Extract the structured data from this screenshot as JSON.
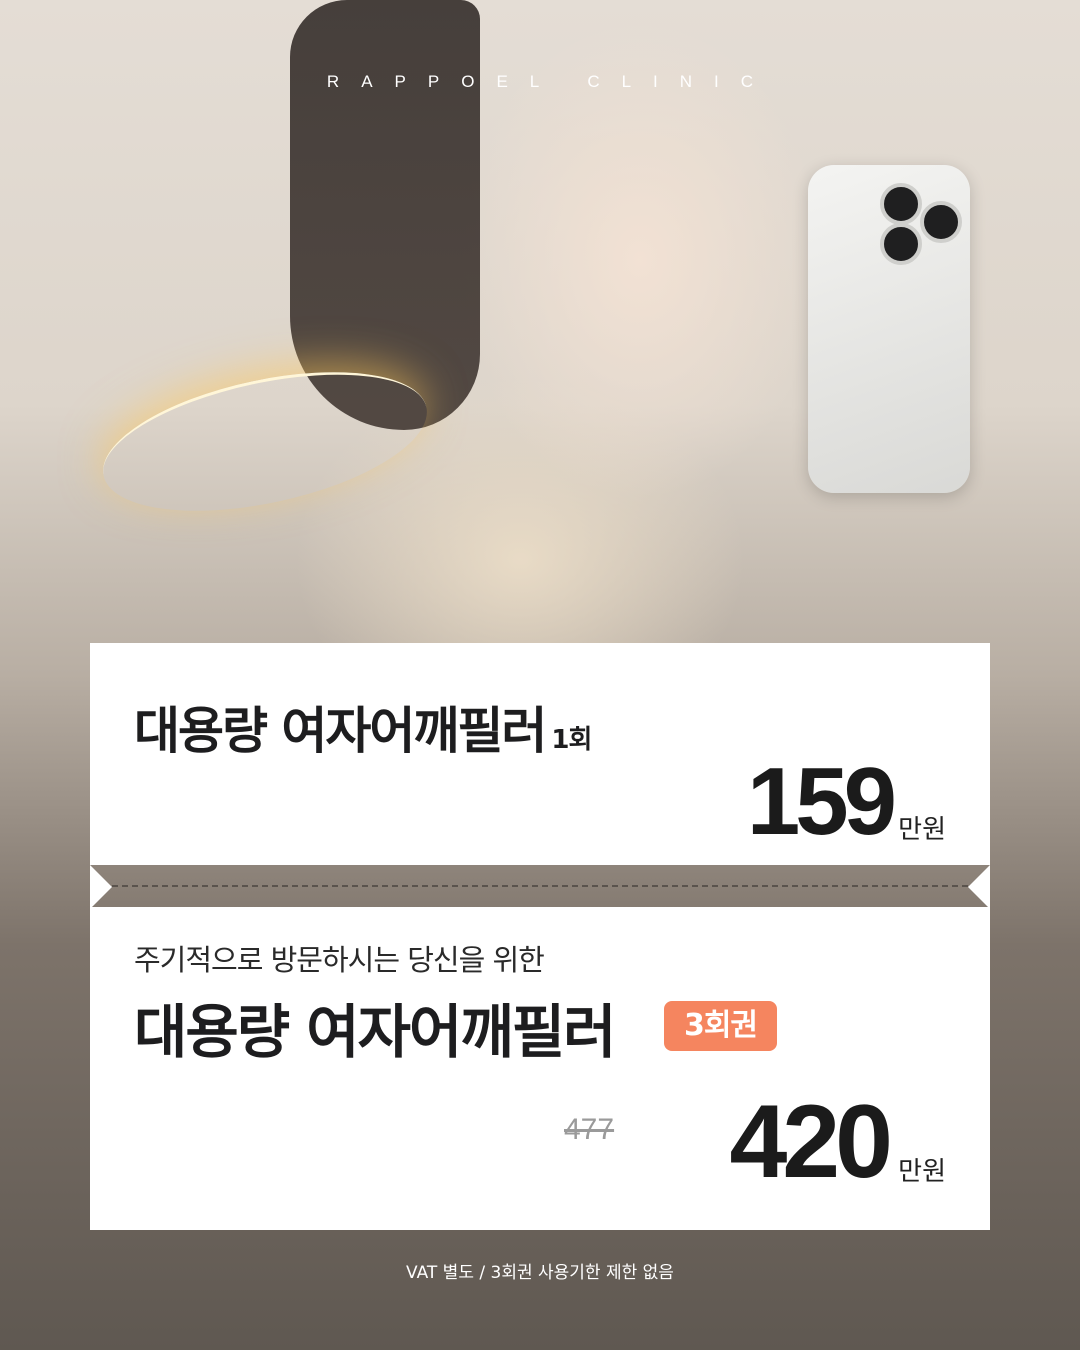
{
  "brand": "RAPPOEL CLINIC",
  "offer1": {
    "title": "대용량 여자어깨필러",
    "count": "1회",
    "price": "159",
    "unit": "만원"
  },
  "offer2": {
    "subtitle": "주기적으로 방문하시는 당신을 위한",
    "title": "대용량 여자어깨필러",
    "badge": "3회권",
    "original_price": "477",
    "price": "420",
    "unit": "만원"
  },
  "footnote": "VAT 별도 / 3회권 사용기한 제한 없음",
  "colors": {
    "badge": "#f5855f",
    "card": "#ffffff",
    "text": "#1d1d1f"
  }
}
